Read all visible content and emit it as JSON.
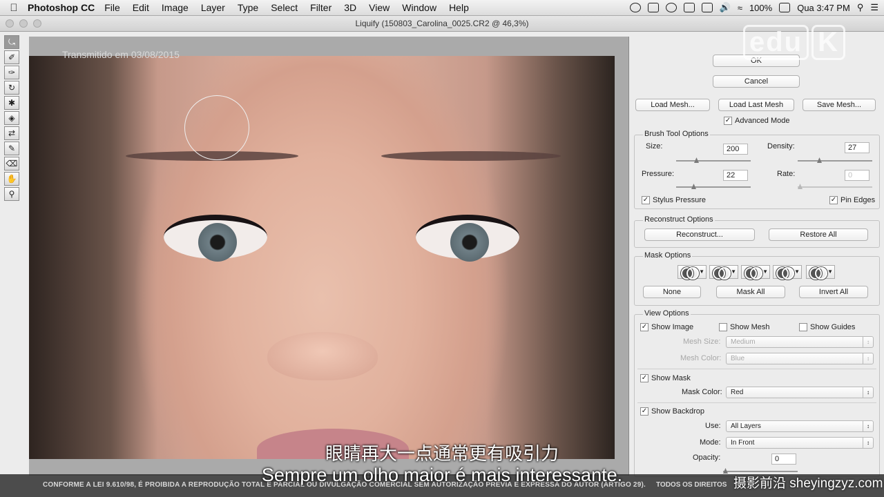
{
  "menubar": {
    "app": "Photoshop CC",
    "items": [
      "File",
      "Edit",
      "Image",
      "Layer",
      "Type",
      "Select",
      "Filter",
      "3D",
      "View",
      "Window",
      "Help"
    ],
    "status": {
      "battery": "100%",
      "clock": "Qua 3:47 PM"
    }
  },
  "window": {
    "title": "Liquify (150803_Carolina_0025.CR2 @ 46,3%)"
  },
  "canvas": {
    "watermark": "Transmitido em 03/08/2015"
  },
  "logo": {
    "text": "edu",
    "mark": "K"
  },
  "dialog": {
    "ok_label": "OK",
    "cancel_label": "Cancel",
    "load_mesh": "Load Mesh...",
    "load_last_mesh": "Load Last Mesh",
    "save_mesh": "Save Mesh...",
    "advanced_mode": "Advanced Mode",
    "brush": {
      "title": "Brush Tool Options",
      "size_label": "Size:",
      "size": "200",
      "density_label": "Density:",
      "density": "27",
      "pressure_label": "Pressure:",
      "pressure": "22",
      "rate_label": "Rate:",
      "rate": "0",
      "stylus_pressure": "Stylus Pressure",
      "pin_edges": "Pin Edges"
    },
    "reconstruct": {
      "title": "Reconstruct Options",
      "reconstruct": "Reconstruct...",
      "restore_all": "Restore All"
    },
    "mask": {
      "title": "Mask Options",
      "none": "None",
      "mask_all": "Mask All",
      "invert_all": "Invert All"
    },
    "view": {
      "title": "View Options",
      "show_image": "Show Image",
      "show_mesh": "Show Mesh",
      "show_guides": "Show Guides",
      "mesh_size_label": "Mesh Size:",
      "mesh_size": "Medium",
      "mesh_color_label": "Mesh Color:",
      "mesh_color": "Blue",
      "show_mask": "Show Mask",
      "mask_color_label": "Mask Color:",
      "mask_color": "Red",
      "show_backdrop": "Show Backdrop",
      "use_label": "Use:",
      "use": "All Layers",
      "mode_label": "Mode:",
      "mode": "In Front",
      "opacity_label": "Opacity:",
      "opacity": "0"
    }
  },
  "overlay": {
    "subtitle_cn": "眼睛再大一点通常更有吸引力",
    "subtitle_pt": "Sempre um olho maior é mais interessante.",
    "legal_left": "CONFORME A LEI 9.610/98, É PROIBIDA A REPRODUÇÃO TOTAL E PARCIAL OU DIVULGAÇÃO COMERCIAL SEM AUTORIZAÇÃO PRÉVIA E EXPRESSA DO AUTOR (ARTIGO 29).",
    "legal_right": "TODOS OS DIREITOS",
    "site": "摄影前沿 sheyingzyz.com"
  }
}
